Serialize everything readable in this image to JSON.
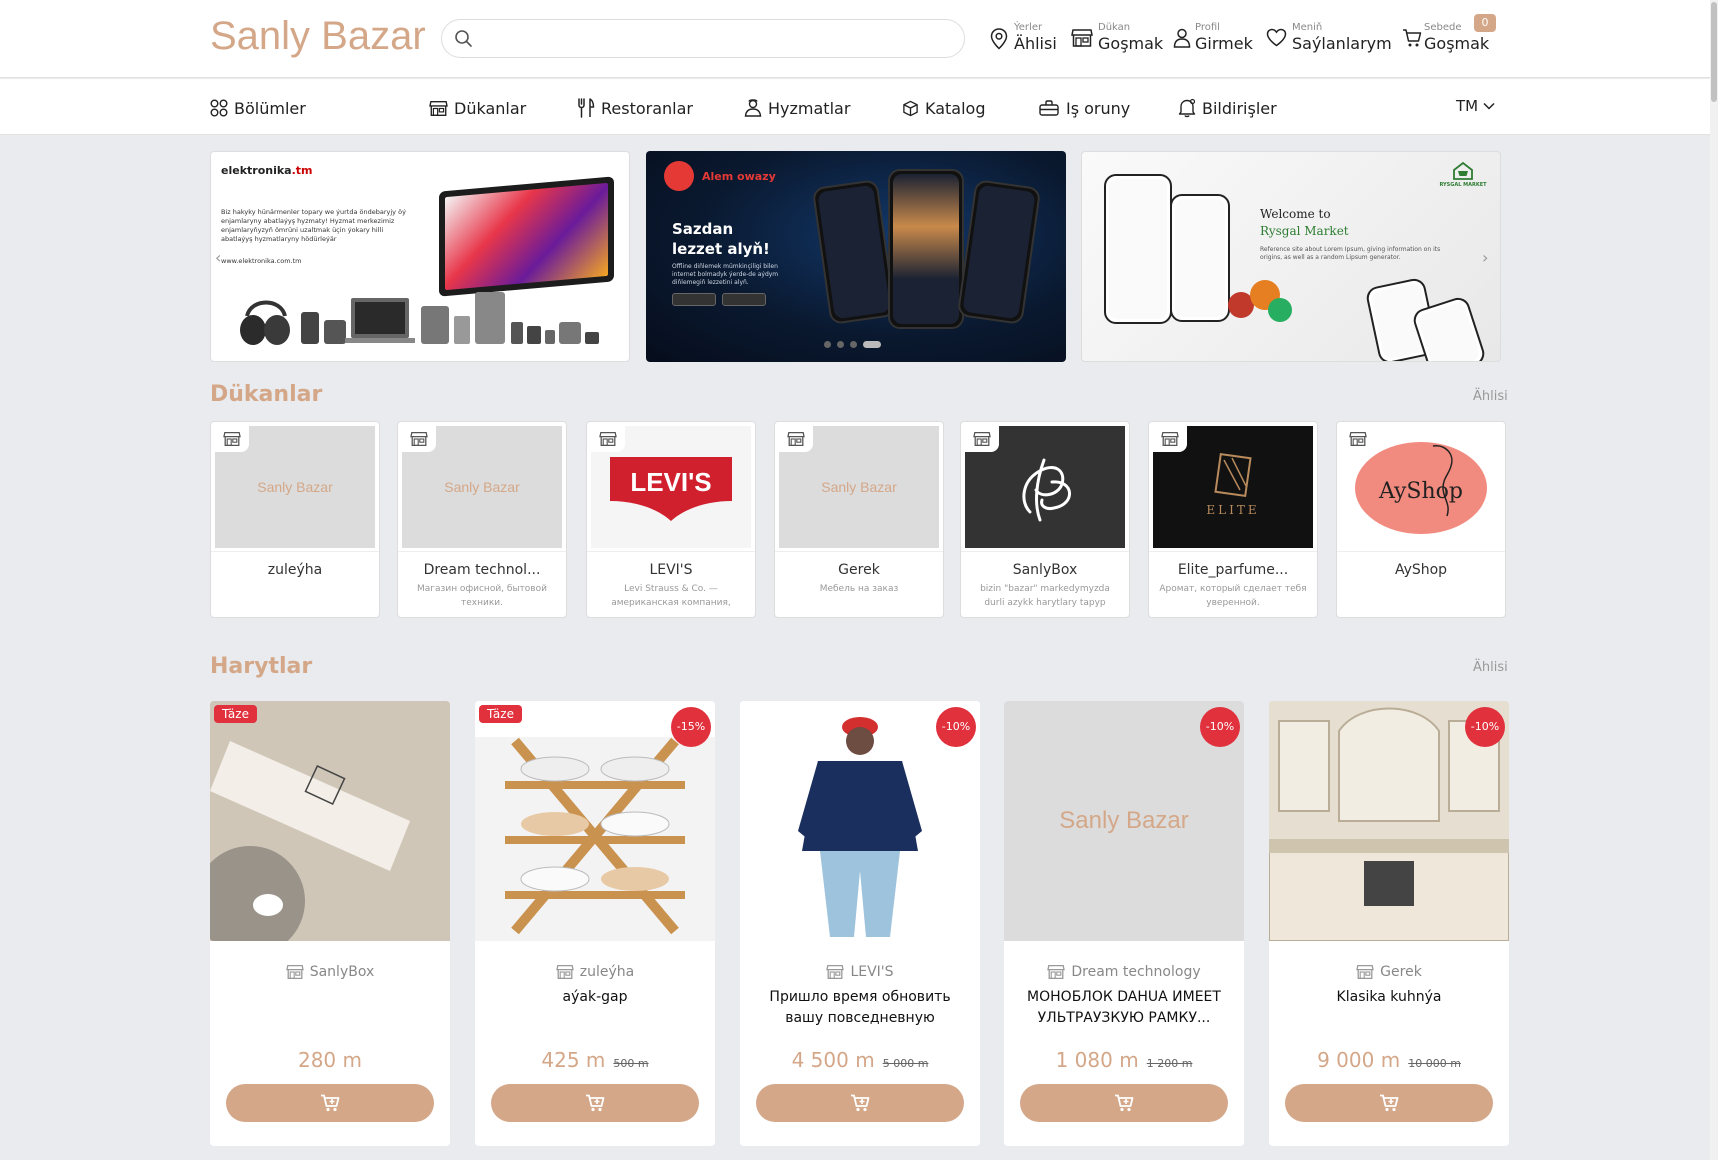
{
  "header": {
    "logo": "Sanly Bazar",
    "search_placeholder": "",
    "links": {
      "places": {
        "small": "Ýerler",
        "label": "Ählisi"
      },
      "shop": {
        "small": "Dükan",
        "label": "Goşmak"
      },
      "profile": {
        "small": "Profil",
        "label": "Girmek"
      },
      "favorites": {
        "small": "Meniň",
        "label": "Saýlanlarym"
      },
      "cart": {
        "small": "Sebede",
        "label": "Goşmak",
        "count": "0"
      }
    }
  },
  "nav": {
    "items": [
      "Bölümler",
      "Dükanlar",
      "Restoranlar",
      "Hyzmatlar",
      "Katalog",
      "Iş oruny",
      "Bildirişler"
    ],
    "language": "TM"
  },
  "banners": {
    "b1": {
      "brand": "elektronika",
      "brand_suffix": ".tm",
      "text": "Biz hakyky hünärmenler topary we ýurtda öndebaryjy öý enjamlaryny abatlaýyş hyzmaty! Hyzmat merkezimiz enjamlaryňyzyň ömrüni uzaltmak üçin ýokary hilli abatlaýyş hyzmatlaryny hödürleýär",
      "url": "www.elektronika.com.tm"
    },
    "b2": {
      "app": "Alem owazy",
      "title_line1": "Sazdan",
      "title_line2": "lezzet alyň!",
      "subtitle": "Offline diňlemek mümkinçiligi bilen internet bolmadyk ýerde-de aýdym diňlemegiň lezzetini alyň."
    },
    "b3": {
      "welcome": "Welcome to",
      "brand": "Rysgal Market",
      "subtitle": "Reference site about Lorem Ipsum, giving information on its origins, as well as a random Lipsum generator.",
      "logo_text": "RYSGAL MARKET"
    }
  },
  "shops_section": {
    "title": "Dükanlar",
    "all": "Ählisi",
    "items": [
      {
        "name": "zuleýha",
        "desc": "",
        "placeholder": "Sanly Bazar"
      },
      {
        "name": "Dream technol...",
        "desc": "Магазин офисной, бытовой техники.",
        "placeholder": "Sanly Bazar"
      },
      {
        "name": "LEVI'S",
        "desc": "Levi Strauss & Co. — американская компания,",
        "logo": "LEVI'S"
      },
      {
        "name": "Gerek",
        "desc": "Мебель на заказ",
        "placeholder": "Sanly Bazar"
      },
      {
        "name": "SanlyBox",
        "desc": "bizin \"bazar\" markedymyzda durli azykk harytlary tapyp"
      },
      {
        "name": "Elite_parfume...",
        "desc": "Аромат, который сделает тебя уверенной.",
        "logo": "ELITE"
      },
      {
        "name": "AyShop",
        "desc": "",
        "logo": "AyShop"
      }
    ]
  },
  "products_section": {
    "title": "Harytlar",
    "all": "Ählisi",
    "items": [
      {
        "shop": "SanlyBox",
        "name": "",
        "price": "280 m",
        "old_price": "",
        "badge_new": "Täze",
        "discount": ""
      },
      {
        "shop": "zuleýha",
        "name": "aýak-gap",
        "price": "425 m",
        "old_price": "500 m",
        "badge_new": "Täze",
        "discount": "-15%"
      },
      {
        "shop": "LEVI'S",
        "name": "Пришло время обновить вашу повседневную верхнюю одеж...",
        "price": "4 500 m",
        "old_price": "5 000 m",
        "badge_new": "",
        "discount": "-10%"
      },
      {
        "shop": "Dream technology",
        "name": "МОНОБЛОК DAHUA ИМЕЕТ УЛЬТРАУЗКУЮ РАМКУ...",
        "price": "1 080 m",
        "old_price": "1 200 m",
        "badge_new": "",
        "discount": "-10%",
        "placeholder": "Sanly Bazar"
      },
      {
        "shop": "Gerek",
        "name": "Klasika kuhnýa",
        "price": "9 000 m",
        "old_price": "10 000 m",
        "badge_new": "",
        "discount": "-10%"
      }
    ]
  },
  "colors": {
    "accent": "#d4a788",
    "sale": "#e0313d",
    "page_bg": "#e9ebee"
  }
}
